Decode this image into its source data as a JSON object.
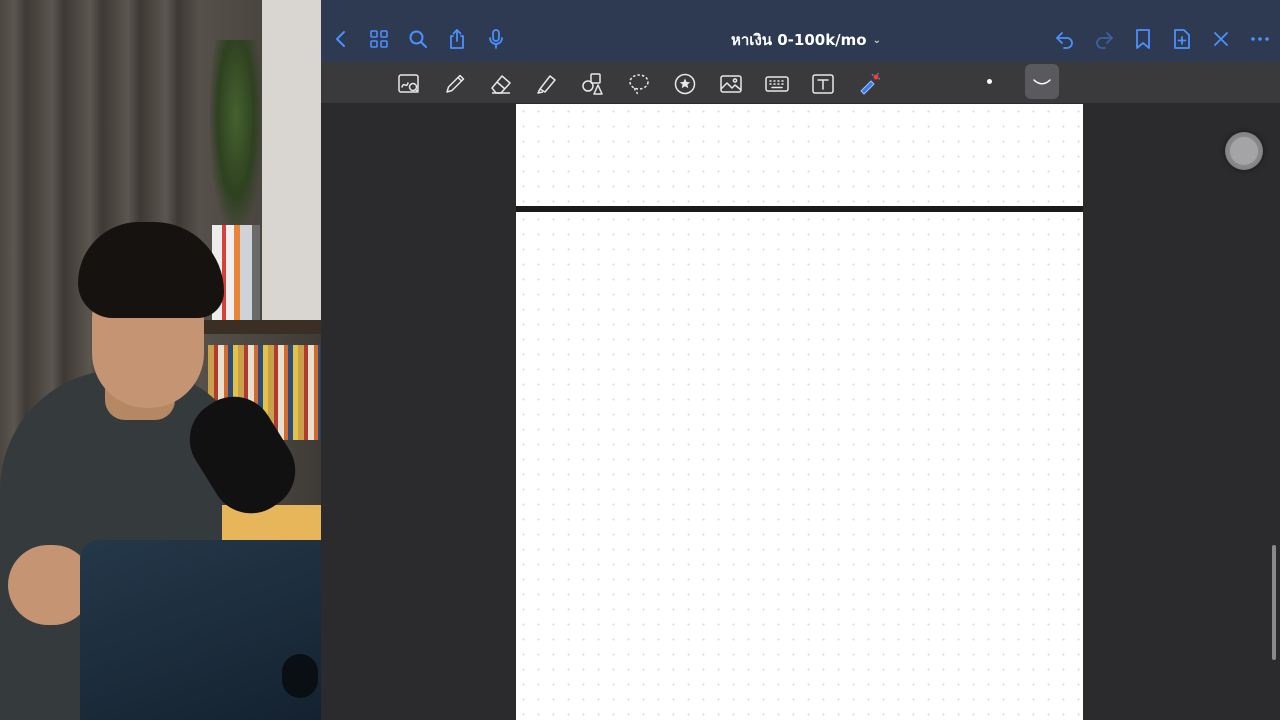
{
  "camera": {
    "description_icon": "person-webcam"
  },
  "nav": {
    "title": "หาเงิน 0-100k/mo",
    "title_chevron": "⌄",
    "icons": [
      "back-icon",
      "grid-icon",
      "search-icon",
      "share-icon",
      "microphone-icon",
      "undo-icon",
      "redo-icon",
      "bookmark-icon",
      "add-page-icon",
      "close-icon",
      "more-icon"
    ],
    "accent_color": "#4a90ff"
  },
  "toolbar": {
    "tools": [
      "zoom-window-icon",
      "pen-icon",
      "eraser-icon",
      "highlighter-icon",
      "shapes-icon",
      "lasso-icon",
      "elements-icon",
      "image-icon",
      "keyboard-icon",
      "text-icon",
      "laser-pointer-icon"
    ],
    "active_color": "#e8e8ea"
  },
  "canvas": {
    "page_background": "#ffffff",
    "dot_grid": true
  }
}
